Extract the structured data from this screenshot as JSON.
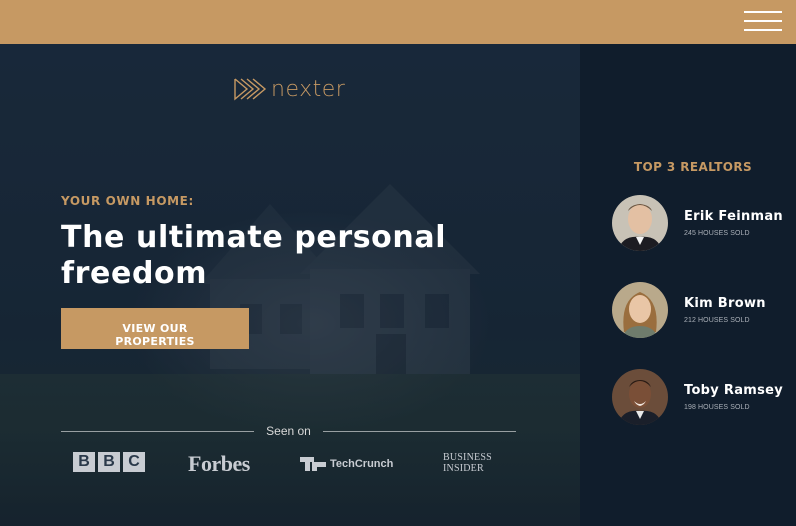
{
  "header": {
    "menu_icon": "hamburger-menu-icon",
    "accent_color": "#c69963"
  },
  "brand": {
    "logo_text": "nexter",
    "logo_icon": "play-chevrons-icon"
  },
  "hero": {
    "subtitle": "YOUR OWN HOME:",
    "heading": "The ultimate personal freedom",
    "cta_label": "VIEW OUR PROPERTIES"
  },
  "seen_on": {
    "label": "Seen on",
    "logos": {
      "bbc": [
        "B",
        "B",
        "C"
      ],
      "forbes": "Forbes",
      "techcrunch": "TechCrunch",
      "business_insider_line1": "BUSINESS",
      "business_insider_line2": "INSIDER"
    }
  },
  "sidebar": {
    "title": "TOP 3 REALTORS",
    "realtors": [
      {
        "name": "Erik Feinman",
        "sold": "245 HOUSES SOLD"
      },
      {
        "name": "Kim Brown",
        "sold": "212 HOUSES SOLD"
      },
      {
        "name": "Toby Ramsey",
        "sold": "198 HOUSES SOLD"
      }
    ]
  },
  "colors": {
    "primary": "#c69963",
    "dark": "#101d2c",
    "white": "#ffffff"
  }
}
